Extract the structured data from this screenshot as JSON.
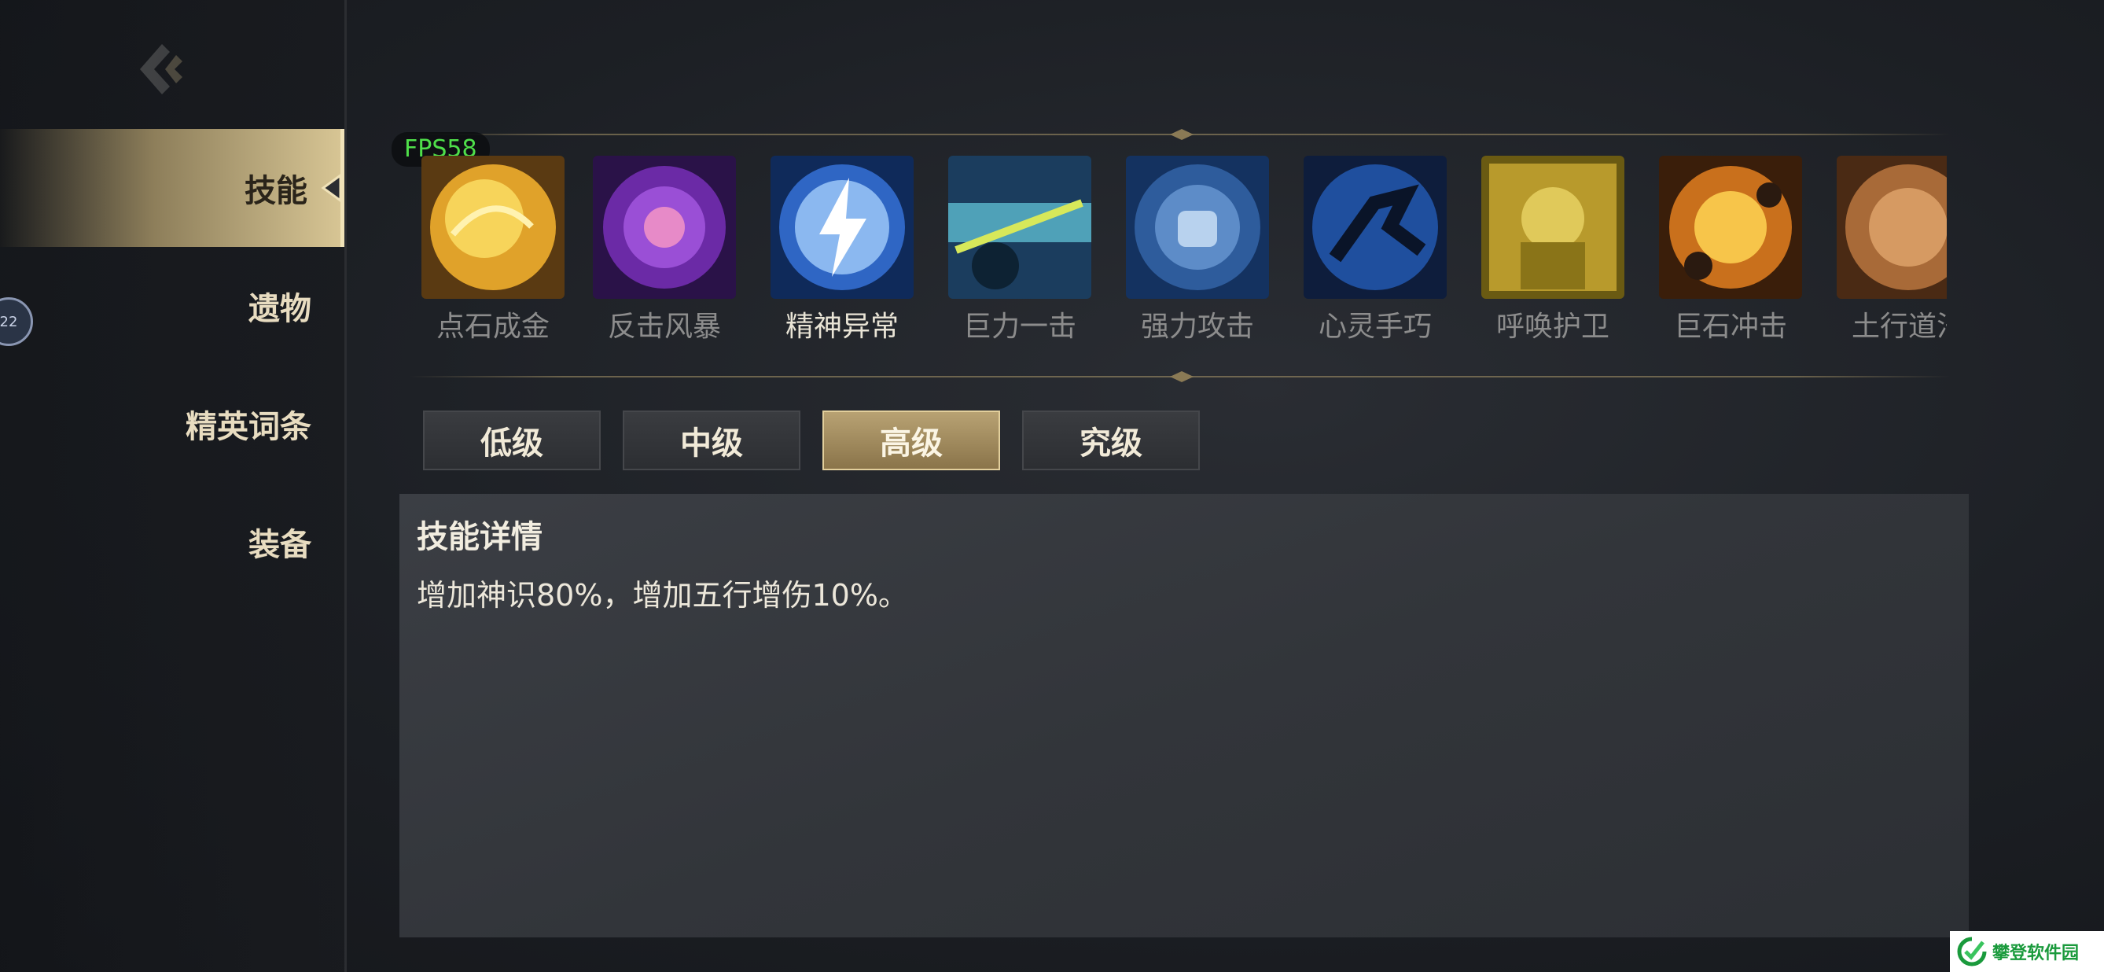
{
  "fps": "FPS58",
  "nav": {
    "items": [
      {
        "label": "技能",
        "active": true
      },
      {
        "label": "遗物",
        "active": false
      },
      {
        "label": "精英词条",
        "active": false
      },
      {
        "label": "装备",
        "active": false
      }
    ],
    "badge": "22"
  },
  "skills": [
    {
      "name": "点石成金",
      "icon": "golden-orb-icon",
      "active": false
    },
    {
      "name": "反击风暴",
      "icon": "purple-vortex-icon",
      "active": false
    },
    {
      "name": "精神异常",
      "icon": "lightning-orb-icon",
      "active": true
    },
    {
      "name": "巨力一击",
      "icon": "power-strike-icon",
      "active": false
    },
    {
      "name": "强力攻击",
      "icon": "fist-orb-icon",
      "active": false
    },
    {
      "name": "心灵手巧",
      "icon": "dash-orb-icon",
      "active": false
    },
    {
      "name": "呼唤护卫",
      "icon": "guardian-icon",
      "active": false
    },
    {
      "name": "巨石冲击",
      "icon": "boulder-blast-icon",
      "active": false
    },
    {
      "name": "土行道法",
      "icon": "earth-orb-icon",
      "active": false
    }
  ],
  "tiers": [
    {
      "label": "低级",
      "active": false
    },
    {
      "label": "中级",
      "active": false
    },
    {
      "label": "高级",
      "active": true
    },
    {
      "label": "究级",
      "active": false
    }
  ],
  "details": {
    "title": "技能详情",
    "text": "增加神识80%，增加五行增伤10%。"
  },
  "watermark": "攀登软件园",
  "colors": {
    "accent_gold": "#d7c594",
    "fps_green": "#4fe04a",
    "inactive_text": "#8c8c8c"
  }
}
